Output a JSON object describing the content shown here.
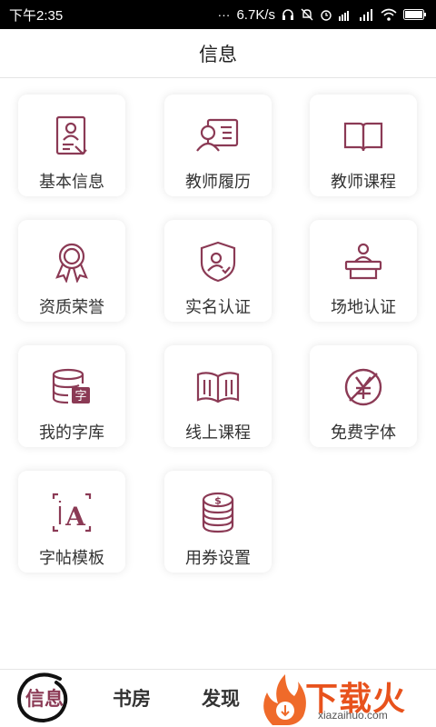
{
  "status_bar": {
    "time": "下午2:35",
    "speed": "6.7K/s",
    "icons": [
      "more-icon",
      "headset-icon",
      "mute-icon",
      "alarm-icon",
      "hd-signal-icon",
      "signal-icon",
      "wifi-icon",
      "battery-icon"
    ]
  },
  "header": {
    "title": "信息"
  },
  "accent_color": "#8b3a55",
  "menu": [
    {
      "label": "基本信息",
      "icon": "profile-card-icon"
    },
    {
      "label": "教师履历",
      "icon": "resume-icon"
    },
    {
      "label": "教师课程",
      "icon": "open-book-icon"
    },
    {
      "label": "资质荣誉",
      "icon": "medal-icon"
    },
    {
      "label": "实名认证",
      "icon": "shield-user-icon"
    },
    {
      "label": "场地认证",
      "icon": "podium-icon"
    },
    {
      "label": "我的字库",
      "icon": "font-database-icon"
    },
    {
      "label": "线上课程",
      "icon": "online-course-book-icon"
    },
    {
      "label": "免费字体",
      "icon": "free-yen-icon"
    },
    {
      "label": "字帖模板",
      "icon": "copybook-template-icon"
    },
    {
      "label": "用券设置",
      "icon": "coin-stack-icon"
    }
  ],
  "tabs": [
    {
      "label": "信息",
      "active": true
    },
    {
      "label": "书房",
      "active": false
    },
    {
      "label": "发现",
      "active": false
    }
  ],
  "watermark": {
    "text": "下载火",
    "url": "xiazaihuo.com"
  }
}
